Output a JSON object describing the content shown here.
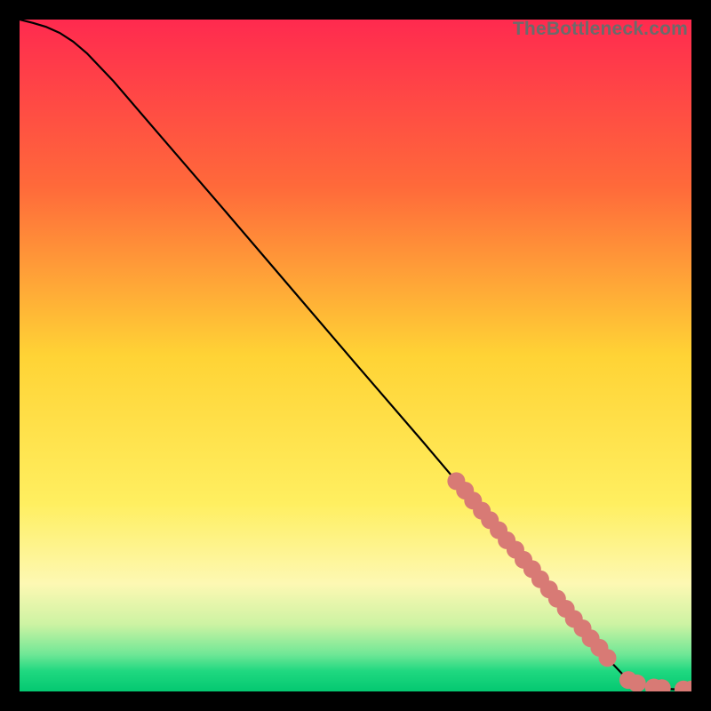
{
  "watermark": "TheBottleneck.com",
  "chart_data": {
    "type": "line",
    "title": "",
    "xlabel": "",
    "ylabel": "",
    "xlim": [
      0,
      100
    ],
    "ylim": [
      0,
      100
    ],
    "grid": false,
    "legend": false,
    "background_gradient": {
      "stops": [
        {
          "offset": 0.0,
          "color": "#ff2a4f"
        },
        {
          "offset": 0.25,
          "color": "#ff6a3a"
        },
        {
          "offset": 0.5,
          "color": "#ffd335"
        },
        {
          "offset": 0.72,
          "color": "#ffef60"
        },
        {
          "offset": 0.84,
          "color": "#fdf8b3"
        },
        {
          "offset": 0.9,
          "color": "#cdf3a3"
        },
        {
          "offset": 0.945,
          "color": "#6fe796"
        },
        {
          "offset": 0.97,
          "color": "#1fd880"
        },
        {
          "offset": 1.0,
          "color": "#04c871"
        }
      ]
    },
    "series": [
      {
        "name": "curve",
        "type": "line",
        "color": "#000000",
        "x": [
          0.0,
          2.0,
          4.0,
          6.0,
          8.0,
          10.0,
          14.0,
          20.0,
          30.0,
          40.0,
          50.0,
          60.0,
          65.0,
          70.0,
          73.0,
          75.0,
          78.0,
          80.0,
          82.0,
          84.0,
          85.0,
          86.0,
          88.0,
          90.0,
          92.0,
          94.0,
          96.0,
          98.0,
          99.0,
          100.0
        ],
        "y": [
          100.0,
          99.5,
          98.9,
          98.0,
          96.7,
          95.0,
          90.8,
          83.8,
          72.2,
          60.5,
          48.8,
          37.2,
          31.3,
          25.5,
          22.0,
          19.6,
          16.1,
          13.8,
          11.5,
          9.1,
          7.9,
          6.8,
          4.4,
          2.3,
          1.1,
          0.6,
          0.4,
          0.3,
          0.3,
          0.3
        ]
      },
      {
        "name": "dots",
        "type": "scatter",
        "color": "#d87a75",
        "x": [
          65.0,
          66.3,
          67.5,
          68.8,
          70.0,
          71.3,
          72.5,
          73.8,
          75.0,
          76.3,
          77.5,
          78.8,
          80.0,
          81.3,
          82.5,
          83.8,
          85.0,
          86.3,
          87.5,
          90.6,
          91.9,
          94.4,
          95.6,
          98.8,
          100.0
        ],
        "y": [
          31.3,
          29.9,
          28.4,
          26.9,
          25.5,
          24.0,
          22.5,
          21.1,
          19.6,
          18.2,
          16.7,
          15.2,
          13.8,
          12.3,
          10.8,
          9.4,
          7.9,
          6.5,
          5.0,
          1.7,
          1.2,
          0.6,
          0.5,
          0.3,
          0.3
        ]
      }
    ]
  }
}
